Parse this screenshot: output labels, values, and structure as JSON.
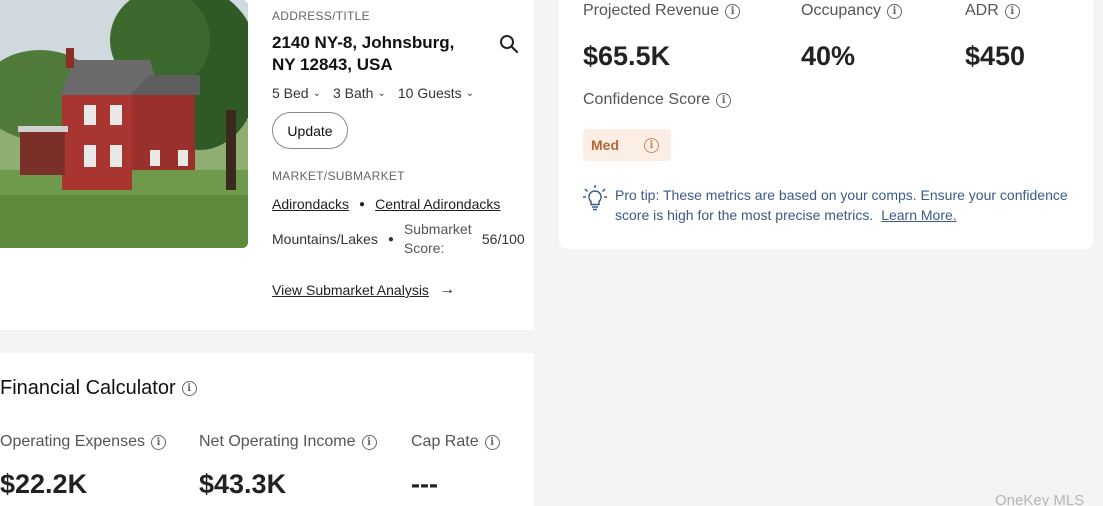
{
  "property": {
    "address_label": "ADDRESS/TITLE",
    "address": "2140 NY-8, Johnsburg, NY 12843, USA",
    "beds": "5 Bed",
    "baths": "3 Bath",
    "guests": "10 Guests",
    "update_label": "Update",
    "market_label": "MARKET/SUBMARKET",
    "market": "Adirondacks",
    "submarket": "Central Adirondacks",
    "terrain": "Mountains/Lakes",
    "submarket_score_label": "Submarket Score:",
    "submarket_score": "56/100",
    "view_analysis": "View Submarket Analysis"
  },
  "metrics": {
    "projected_revenue_label": "Projected Revenue",
    "projected_revenue": "$65.5K",
    "occupancy_label": "Occupancy",
    "occupancy": "40%",
    "adr_label": "ADR",
    "adr": "$450",
    "confidence_label": "Confidence Score",
    "confidence_value": "Med",
    "pro_tip": "Pro tip: These metrics are based on your comps. Ensure your confidence score is high for the most precise metrics.",
    "learn_more": "Learn More."
  },
  "financial": {
    "title": "Financial Calculator",
    "opex_label": "Operating Expenses",
    "opex": "$22.2K",
    "noi_label": "Net Operating Income",
    "noi": "$43.3K",
    "cap_rate_label": "Cap Rate",
    "cap_rate": "---"
  },
  "watermark": "OneKey MLS",
  "colors": {
    "badge_bg": "#fbeee4",
    "badge_text": "#b4663b",
    "tip_text": "#3b5a8a"
  }
}
